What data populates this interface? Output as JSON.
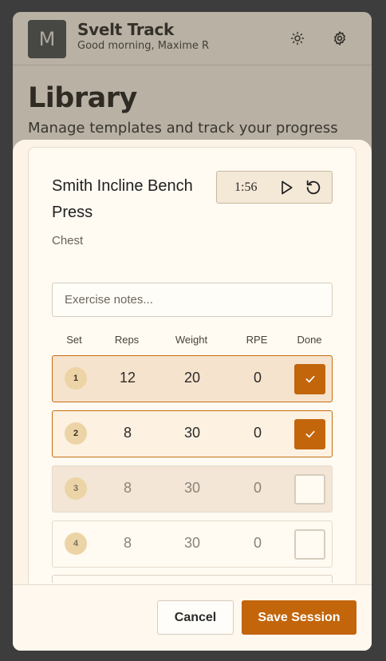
{
  "app": {
    "avatar_letter": "M",
    "title": "Svelt Track",
    "greeting": "Good morning, Maxime R",
    "icons": [
      "sun-icon",
      "gear-icon"
    ]
  },
  "page": {
    "title": "Library",
    "subtitle": "Manage templates and track your progress"
  },
  "exercise": {
    "name": "Smith Incline Bench Press",
    "muscle_group": "Chest",
    "timer": "1:56",
    "notes_placeholder": "Exercise notes...",
    "notes_value": ""
  },
  "table": {
    "headers": {
      "set": "Set",
      "reps": "Reps",
      "weight": "Weight",
      "rpe": "RPE",
      "done": "Done"
    },
    "rows": [
      {
        "set": "1",
        "reps": "12",
        "weight": "20",
        "rpe": "0",
        "done": true
      },
      {
        "set": "2",
        "reps": "8",
        "weight": "30",
        "rpe": "0",
        "done": true
      },
      {
        "set": "3",
        "reps": "8",
        "weight": "30",
        "rpe": "0",
        "done": false
      },
      {
        "set": "4",
        "reps": "8",
        "weight": "30",
        "rpe": "0",
        "done": false
      }
    ]
  },
  "footer": {
    "cancel_label": "Cancel",
    "save_label": "Save Session"
  },
  "colors": {
    "accent": "#c2650b",
    "background": "#fbf6ed",
    "sheet": "#fdf4e7"
  }
}
